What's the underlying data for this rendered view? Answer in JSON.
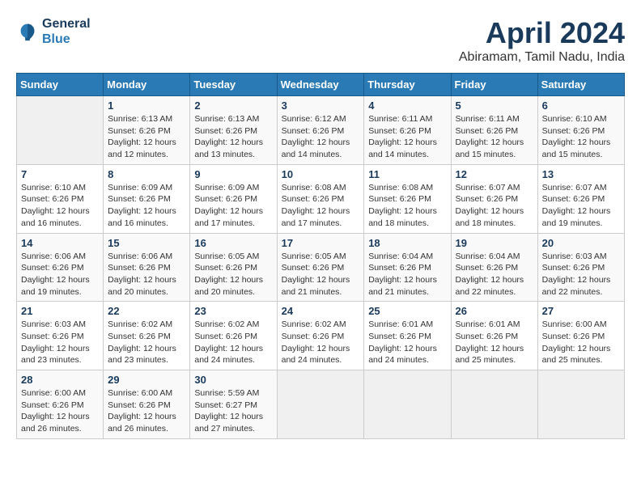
{
  "header": {
    "logo_line1": "General",
    "logo_line2": "Blue",
    "month": "April 2024",
    "location": "Abiramam, Tamil Nadu, India"
  },
  "weekdays": [
    "Sunday",
    "Monday",
    "Tuesday",
    "Wednesday",
    "Thursday",
    "Friday",
    "Saturday"
  ],
  "weeks": [
    [
      {
        "num": "",
        "sunrise": "",
        "sunset": "",
        "daylight": ""
      },
      {
        "num": "1",
        "sunrise": "Sunrise: 6:13 AM",
        "sunset": "Sunset: 6:26 PM",
        "daylight": "Daylight: 12 hours and 12 minutes."
      },
      {
        "num": "2",
        "sunrise": "Sunrise: 6:13 AM",
        "sunset": "Sunset: 6:26 PM",
        "daylight": "Daylight: 12 hours and 13 minutes."
      },
      {
        "num": "3",
        "sunrise": "Sunrise: 6:12 AM",
        "sunset": "Sunset: 6:26 PM",
        "daylight": "Daylight: 12 hours and 14 minutes."
      },
      {
        "num": "4",
        "sunrise": "Sunrise: 6:11 AM",
        "sunset": "Sunset: 6:26 PM",
        "daylight": "Daylight: 12 hours and 14 minutes."
      },
      {
        "num": "5",
        "sunrise": "Sunrise: 6:11 AM",
        "sunset": "Sunset: 6:26 PM",
        "daylight": "Daylight: 12 hours and 15 minutes."
      },
      {
        "num": "6",
        "sunrise": "Sunrise: 6:10 AM",
        "sunset": "Sunset: 6:26 PM",
        "daylight": "Daylight: 12 hours and 15 minutes."
      }
    ],
    [
      {
        "num": "7",
        "sunrise": "Sunrise: 6:10 AM",
        "sunset": "Sunset: 6:26 PM",
        "daylight": "Daylight: 12 hours and 16 minutes."
      },
      {
        "num": "8",
        "sunrise": "Sunrise: 6:09 AM",
        "sunset": "Sunset: 6:26 PM",
        "daylight": "Daylight: 12 hours and 16 minutes."
      },
      {
        "num": "9",
        "sunrise": "Sunrise: 6:09 AM",
        "sunset": "Sunset: 6:26 PM",
        "daylight": "Daylight: 12 hours and 17 minutes."
      },
      {
        "num": "10",
        "sunrise": "Sunrise: 6:08 AM",
        "sunset": "Sunset: 6:26 PM",
        "daylight": "Daylight: 12 hours and 17 minutes."
      },
      {
        "num": "11",
        "sunrise": "Sunrise: 6:08 AM",
        "sunset": "Sunset: 6:26 PM",
        "daylight": "Daylight: 12 hours and 18 minutes."
      },
      {
        "num": "12",
        "sunrise": "Sunrise: 6:07 AM",
        "sunset": "Sunset: 6:26 PM",
        "daylight": "Daylight: 12 hours and 18 minutes."
      },
      {
        "num": "13",
        "sunrise": "Sunrise: 6:07 AM",
        "sunset": "Sunset: 6:26 PM",
        "daylight": "Daylight: 12 hours and 19 minutes."
      }
    ],
    [
      {
        "num": "14",
        "sunrise": "Sunrise: 6:06 AM",
        "sunset": "Sunset: 6:26 PM",
        "daylight": "Daylight: 12 hours and 19 minutes."
      },
      {
        "num": "15",
        "sunrise": "Sunrise: 6:06 AM",
        "sunset": "Sunset: 6:26 PM",
        "daylight": "Daylight: 12 hours and 20 minutes."
      },
      {
        "num": "16",
        "sunrise": "Sunrise: 6:05 AM",
        "sunset": "Sunset: 6:26 PM",
        "daylight": "Daylight: 12 hours and 20 minutes."
      },
      {
        "num": "17",
        "sunrise": "Sunrise: 6:05 AM",
        "sunset": "Sunset: 6:26 PM",
        "daylight": "Daylight: 12 hours and 21 minutes."
      },
      {
        "num": "18",
        "sunrise": "Sunrise: 6:04 AM",
        "sunset": "Sunset: 6:26 PM",
        "daylight": "Daylight: 12 hours and 21 minutes."
      },
      {
        "num": "19",
        "sunrise": "Sunrise: 6:04 AM",
        "sunset": "Sunset: 6:26 PM",
        "daylight": "Daylight: 12 hours and 22 minutes."
      },
      {
        "num": "20",
        "sunrise": "Sunrise: 6:03 AM",
        "sunset": "Sunset: 6:26 PM",
        "daylight": "Daylight: 12 hours and 22 minutes."
      }
    ],
    [
      {
        "num": "21",
        "sunrise": "Sunrise: 6:03 AM",
        "sunset": "Sunset: 6:26 PM",
        "daylight": "Daylight: 12 hours and 23 minutes."
      },
      {
        "num": "22",
        "sunrise": "Sunrise: 6:02 AM",
        "sunset": "Sunset: 6:26 PM",
        "daylight": "Daylight: 12 hours and 23 minutes."
      },
      {
        "num": "23",
        "sunrise": "Sunrise: 6:02 AM",
        "sunset": "Sunset: 6:26 PM",
        "daylight": "Daylight: 12 hours and 24 minutes."
      },
      {
        "num": "24",
        "sunrise": "Sunrise: 6:02 AM",
        "sunset": "Sunset: 6:26 PM",
        "daylight": "Daylight: 12 hours and 24 minutes."
      },
      {
        "num": "25",
        "sunrise": "Sunrise: 6:01 AM",
        "sunset": "Sunset: 6:26 PM",
        "daylight": "Daylight: 12 hours and 24 minutes."
      },
      {
        "num": "26",
        "sunrise": "Sunrise: 6:01 AM",
        "sunset": "Sunset: 6:26 PM",
        "daylight": "Daylight: 12 hours and 25 minutes."
      },
      {
        "num": "27",
        "sunrise": "Sunrise: 6:00 AM",
        "sunset": "Sunset: 6:26 PM",
        "daylight": "Daylight: 12 hours and 25 minutes."
      }
    ],
    [
      {
        "num": "28",
        "sunrise": "Sunrise: 6:00 AM",
        "sunset": "Sunset: 6:26 PM",
        "daylight": "Daylight: 12 hours and 26 minutes."
      },
      {
        "num": "29",
        "sunrise": "Sunrise: 6:00 AM",
        "sunset": "Sunset: 6:26 PM",
        "daylight": "Daylight: 12 hours and 26 minutes."
      },
      {
        "num": "30",
        "sunrise": "Sunrise: 5:59 AM",
        "sunset": "Sunset: 6:27 PM",
        "daylight": "Daylight: 12 hours and 27 minutes."
      },
      {
        "num": "",
        "sunrise": "",
        "sunset": "",
        "daylight": ""
      },
      {
        "num": "",
        "sunrise": "",
        "sunset": "",
        "daylight": ""
      },
      {
        "num": "",
        "sunrise": "",
        "sunset": "",
        "daylight": ""
      },
      {
        "num": "",
        "sunrise": "",
        "sunset": "",
        "daylight": ""
      }
    ]
  ]
}
